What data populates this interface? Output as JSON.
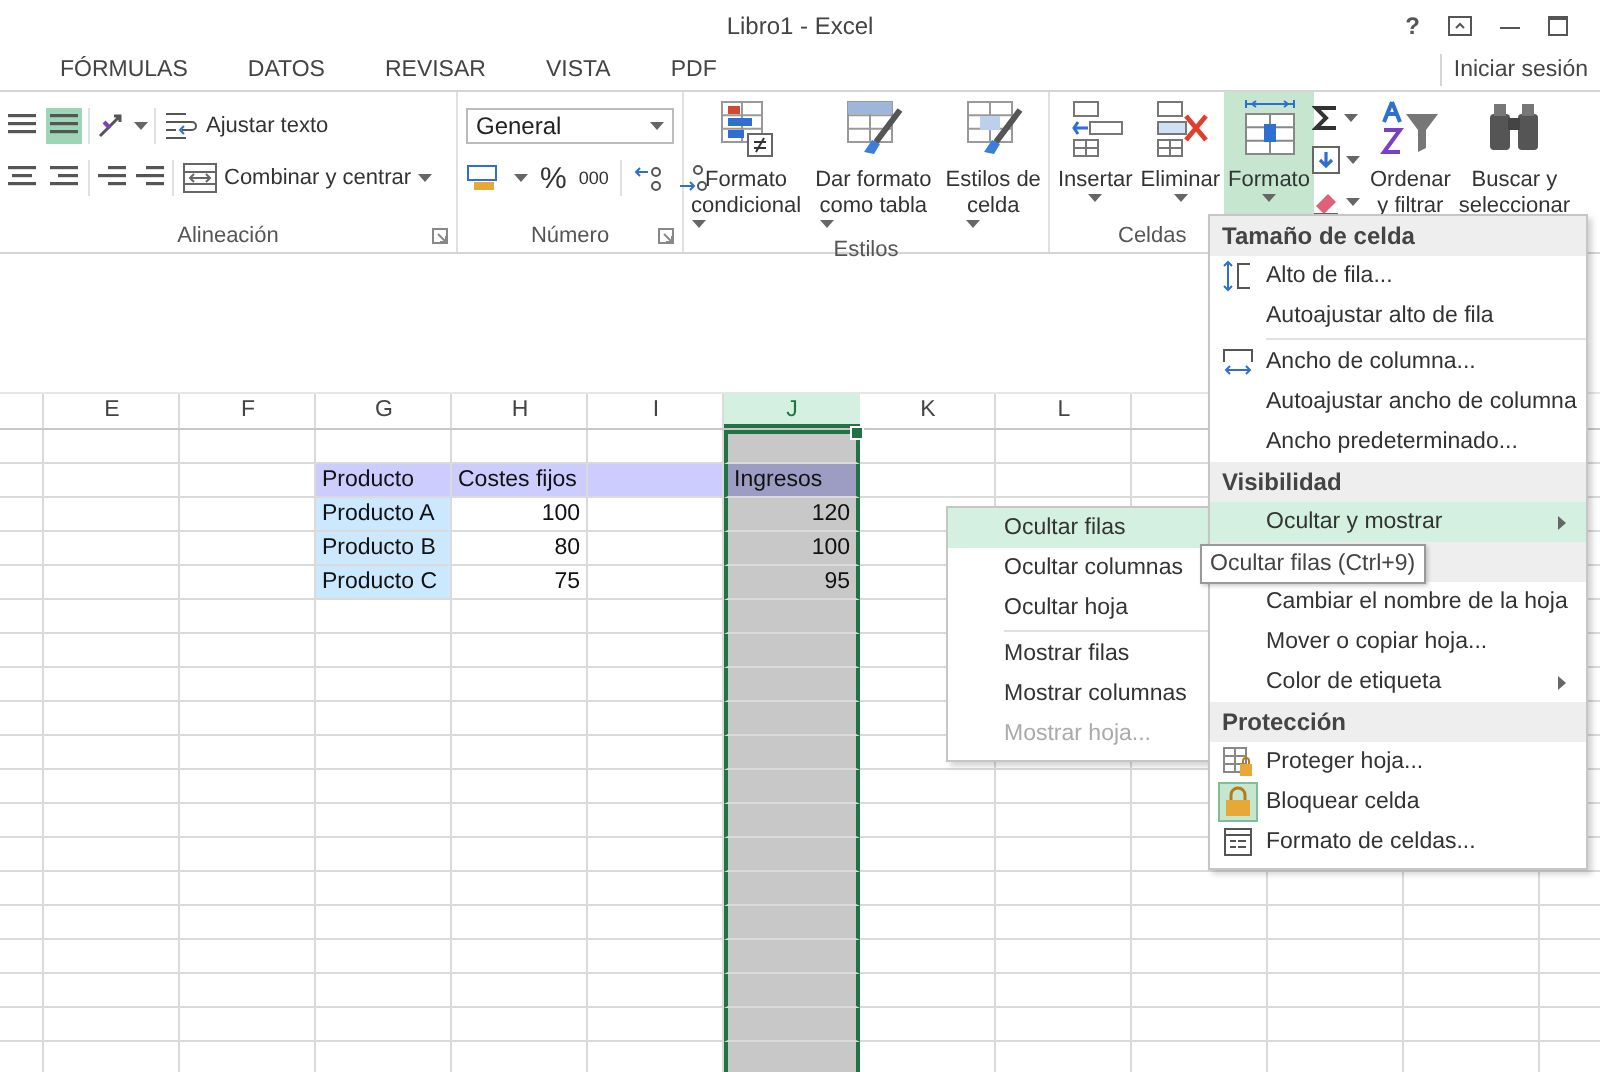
{
  "window": {
    "title": "Libro1 - Excel",
    "help": "?",
    "sign_in": "Iniciar sesión"
  },
  "tabs": [
    {
      "label": "FÓRMULAS",
      "selected": false
    },
    {
      "label": "DATOS",
      "selected": false
    },
    {
      "label": "REVISAR",
      "selected": false
    },
    {
      "label": "VISTA",
      "selected": false
    },
    {
      "label": "PDF",
      "selected": false
    }
  ],
  "alignment": {
    "label": "Alineación",
    "align_buttons": [
      {
        "selected": false
      },
      {
        "selected": true
      },
      {
        "selected": false
      },
      {
        "selected": false
      }
    ],
    "wrap_text": "Ajustar texto",
    "merge": "Combinar y centrar"
  },
  "number": {
    "label": "Número",
    "format": "General",
    "percent": "%",
    "thousands": "000"
  },
  "styles": {
    "label": "Estilos",
    "buttons": [
      {
        "lines": [
          "Formato",
          "condicional"
        ]
      },
      {
        "lines": [
          "Dar formato",
          "como tabla"
        ]
      },
      {
        "lines": [
          "Estilos de",
          "celda"
        ]
      }
    ]
  },
  "cells": {
    "label": "Celdas",
    "buttons": [
      {
        "label": "Insertar",
        "selected": false
      },
      {
        "label": "Eliminar",
        "selected": false
      },
      {
        "label": "Formato",
        "selected": true
      }
    ]
  },
  "editing": {
    "buttons": [
      {
        "lines": [
          "Ordenar",
          "y filtrar"
        ]
      },
      {
        "lines": [
          "Buscar y",
          "seleccionar"
        ]
      }
    ]
  },
  "sheet": {
    "columns": [
      {
        "letter": "E",
        "selected": false
      },
      {
        "letter": "F",
        "selected": false
      },
      {
        "letter": "G",
        "selected": false
      },
      {
        "letter": "H",
        "selected": false
      },
      {
        "letter": "I",
        "selected": false
      },
      {
        "letter": "J",
        "selected": true
      },
      {
        "letter": "K",
        "selected": false
      },
      {
        "letter": "L",
        "selected": false
      }
    ],
    "rows": [
      {
        "cells": [
          {
            "kind": "header",
            "text": "Producto"
          },
          {
            "kind": "header",
            "text": "Costes fijos"
          },
          {
            "kind": "header"
          },
          {
            "kind": "header",
            "text": "Ingresos"
          }
        ]
      },
      {
        "cells": [
          {
            "kind": "label",
            "text": "Producto A"
          },
          {
            "kind": "number",
            "text": "100"
          },
          {
            "kind": "empty"
          },
          {
            "kind": "number",
            "text": "120"
          }
        ]
      },
      {
        "cells": [
          {
            "kind": "label",
            "text": "Producto B"
          },
          {
            "kind": "number",
            "text": "80"
          },
          {
            "kind": "empty"
          },
          {
            "kind": "number",
            "text": "100"
          }
        ]
      },
      {
        "cells": [
          {
            "kind": "label",
            "text": "Producto C"
          },
          {
            "kind": "number",
            "text": "75"
          },
          {
            "kind": "empty"
          },
          {
            "kind": "number",
            "text": "95"
          }
        ]
      }
    ]
  },
  "format_menu": {
    "sections": [
      {
        "title": "Tamaño de celda",
        "items": [
          {
            "kind": "command",
            "label": "Alto de fila...",
            "selected": false,
            "checked": false
          },
          {
            "kind": "command",
            "label": "Autoajustar alto de fila",
            "selected": false,
            "checked": false
          },
          {
            "kind": "separator"
          },
          {
            "kind": "command",
            "label": "Ancho de columna...",
            "selected": false,
            "checked": false
          },
          {
            "kind": "command",
            "label": "Autoajustar ancho de columna",
            "selected": false,
            "checked": false
          },
          {
            "kind": "command",
            "label": "Ancho predeterminado...",
            "selected": false,
            "checked": false
          }
        ]
      },
      {
        "title": "Visibilidad",
        "items": [
          {
            "kind": "submenu",
            "label": "Ocultar y mostrar",
            "selected": true,
            "checked": false
          }
        ]
      },
      {
        "items": [
          {
            "kind": "command",
            "label": "Cambiar el nombre de la hoja",
            "selected": false,
            "checked": false
          },
          {
            "kind": "command",
            "label": "Mover o copiar hoja...",
            "selected": false,
            "checked": false
          },
          {
            "kind": "submenu",
            "label": "Color de etiqueta",
            "selected": false,
            "checked": false
          }
        ]
      },
      {
        "title": "Protección",
        "items": [
          {
            "kind": "command",
            "label": "Proteger hoja...",
            "selected": false,
            "checked": false
          },
          {
            "kind": "command",
            "label": "Bloquear celda",
            "selected": false,
            "checked": true
          },
          {
            "kind": "command",
            "label": "Formato de celdas...",
            "selected": false,
            "checked": false
          }
        ]
      }
    ]
  },
  "submenu": {
    "items": [
      {
        "kind": "command",
        "label": "Ocultar filas",
        "selected": true,
        "disabled": false
      },
      {
        "kind": "command",
        "label": "Ocultar columnas",
        "selected": false,
        "disabled": false
      },
      {
        "kind": "command",
        "label": "Ocultar hoja",
        "selected": false,
        "disabled": false
      },
      {
        "kind": "separator"
      },
      {
        "kind": "command",
        "label": "Mostrar filas",
        "selected": false,
        "disabled": false
      },
      {
        "kind": "command",
        "label": "Mostrar columnas",
        "selected": false,
        "disabled": false
      },
      {
        "kind": "command",
        "label": "Mostrar hoja...",
        "selected": false,
        "disabled": true
      }
    ]
  },
  "tooltip": "Ocultar filas (Ctrl+9)"
}
